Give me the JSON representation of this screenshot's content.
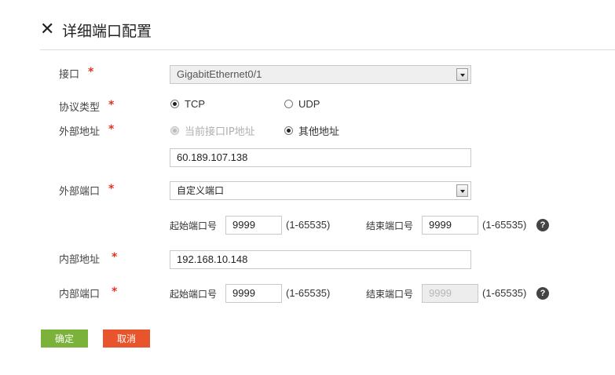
{
  "dialog": {
    "title": "详细端口配置",
    "close_symbol": "✕"
  },
  "form": {
    "required_mark": "*",
    "interface": {
      "label": "接口",
      "value": "GigabitEthernet0/1"
    },
    "protocol": {
      "label": "协议类型",
      "options": [
        "TCP",
        "UDP"
      ],
      "selected": "TCP"
    },
    "external_address": {
      "label": "外部地址",
      "options": [
        "当前接口IP地址",
        "其他地址"
      ],
      "selected": "其他地址",
      "value": "60.189.107.138"
    },
    "external_port": {
      "label": "外部端口",
      "value": "自定义端口",
      "start_label": "起始端口号",
      "start_value": "9999",
      "start_range": "(1-65535)",
      "end_label": "结束端口号",
      "end_value": "9999",
      "end_range": "(1-65535)",
      "help_symbol": "?"
    },
    "internal_address": {
      "label": "内部地址",
      "value": "192.168.10.148"
    },
    "internal_port": {
      "label": "内部端口",
      "start_label": "起始端口号",
      "start_value": "9999",
      "start_range": "(1-65535)",
      "end_label": "结束端口号",
      "end_placeholder": "9999",
      "end_range": "(1-65535)",
      "help_symbol": "?"
    }
  },
  "buttons": {
    "ok": "确定",
    "cancel": "取消"
  },
  "colors": {
    "ok_button": "#7bb23a",
    "cancel_button": "#e8542b",
    "required": "#e0341b"
  }
}
